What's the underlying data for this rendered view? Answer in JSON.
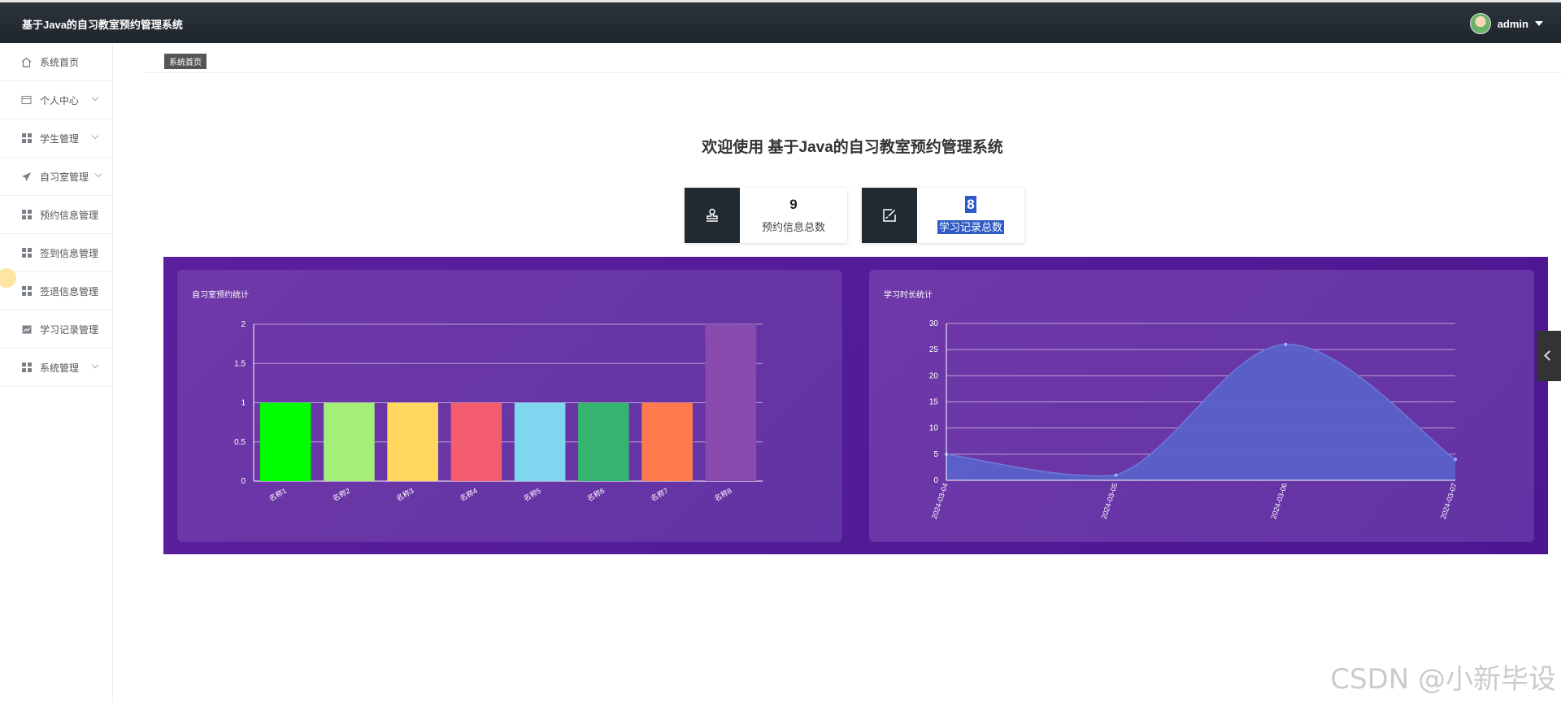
{
  "header": {
    "title": "基于Java的自习教室预约管理系统",
    "user": "admin"
  },
  "sidebar": {
    "items": [
      {
        "label": "系统首页",
        "icon": "home-icon",
        "expandable": false
      },
      {
        "label": "个人中心",
        "icon": "card-icon",
        "expandable": true
      },
      {
        "label": "学生管理",
        "icon": "grid-icon",
        "expandable": true
      },
      {
        "label": "自习室管理",
        "icon": "send-icon",
        "expandable": true
      },
      {
        "label": "预约信息管理",
        "icon": "grid-icon",
        "expandable": false
      },
      {
        "label": "签到信息管理",
        "icon": "grid-icon",
        "expandable": false
      },
      {
        "label": "签退信息管理",
        "icon": "grid-icon",
        "expandable": false
      },
      {
        "label": "学习记录管理",
        "icon": "chart-icon",
        "expandable": false
      },
      {
        "label": "系统管理",
        "icon": "grid-icon",
        "expandable": true
      }
    ]
  },
  "breadcrumb": {
    "current": "系统首页"
  },
  "welcome": "欢迎使用 基于Java的自习教室预约管理系统",
  "stats": [
    {
      "value": "9",
      "label": "预约信息总数",
      "icon": "stamp-icon"
    },
    {
      "value": "8",
      "label": "学习记录总数",
      "icon": "edit-icon"
    }
  ],
  "colors": {
    "header": "#222a31",
    "dashboard_bg": "#52198f",
    "area_fill": "#5a62c9"
  },
  "chart_data": [
    {
      "type": "bar",
      "title": "自习室预约统计",
      "categories": [
        "名称1",
        "名称2",
        "名称3",
        "名称4",
        "名称5",
        "名称6",
        "名称7",
        "名称8"
      ],
      "values": [
        1,
        1,
        1,
        1,
        1,
        1,
        1,
        2
      ],
      "colors": [
        "#00ff00",
        "#a3ef78",
        "#ffd75e",
        "#f25c6e",
        "#7fd6ef",
        "#35b46f",
        "#ff7a4d",
        "#8a4bb0"
      ],
      "ylim": [
        0,
        2
      ],
      "yticks": [
        "0",
        "0.5",
        "1",
        "1.5",
        "2"
      ],
      "grid": true
    },
    {
      "type": "area",
      "title": "学习时长统计",
      "categories": [
        "2024-03-04",
        "2024-03-05",
        "2024-03-06",
        "2024-03-07"
      ],
      "values": [
        5,
        1,
        26,
        4
      ],
      "ylim": [
        0,
        30
      ],
      "yticks": [
        "0",
        "5",
        "10",
        "15",
        "20",
        "25",
        "30"
      ],
      "grid": true
    }
  ],
  "watermark": "CSDN @小新毕设"
}
